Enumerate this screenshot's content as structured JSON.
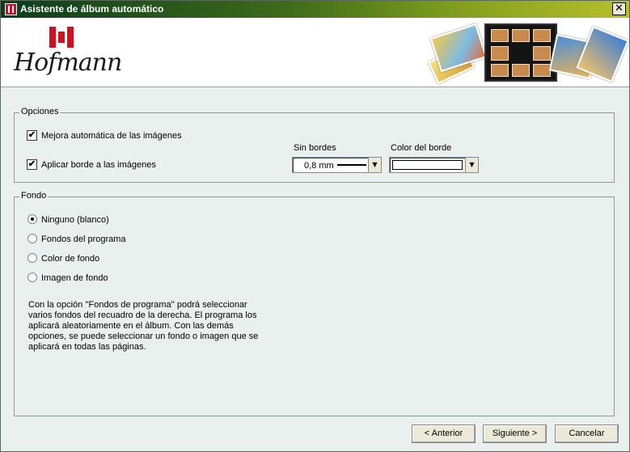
{
  "window": {
    "title": "Asistente de álbum automático",
    "close_glyph": "✕",
    "brand": "Hofmann",
    "titlebar_gradient": [
      "#0b3d1c",
      "#b7be2c"
    ]
  },
  "opciones": {
    "legend": "Opciones",
    "auto_enhance": {
      "label": "Mejora automática de las imágenes",
      "checked": true
    },
    "apply_border": {
      "label": "Aplicar borde a las imágenes",
      "checked": true
    },
    "border_width": {
      "label": "Sin bordes",
      "value": "0,8 mm"
    },
    "border_color": {
      "label": "Color del borde",
      "value": "#ffffff"
    }
  },
  "fondo": {
    "legend": "Fondo",
    "options": [
      {
        "label": "Ninguno (blanco)",
        "selected": true
      },
      {
        "label": "Fondos del programa",
        "selected": false
      },
      {
        "label": "Color de fondo",
        "selected": false
      },
      {
        "label": "Imagen de fondo",
        "selected": false
      }
    ],
    "description": "Con la opción ''Fondos de programa'' podrá seleccionar varios fondos del recuadro de la derecha. El programa los aplicará aleatoriamente en el álbum. Con las demás opciones, se puede seleccionar un fondo o imagen que se aplicará en todas las páginas."
  },
  "buttons": {
    "back": "< Anterior",
    "next": "Siguiente >",
    "cancel": "Cancelar"
  },
  "icons": {
    "check": "✔",
    "dropdown": "▼"
  }
}
